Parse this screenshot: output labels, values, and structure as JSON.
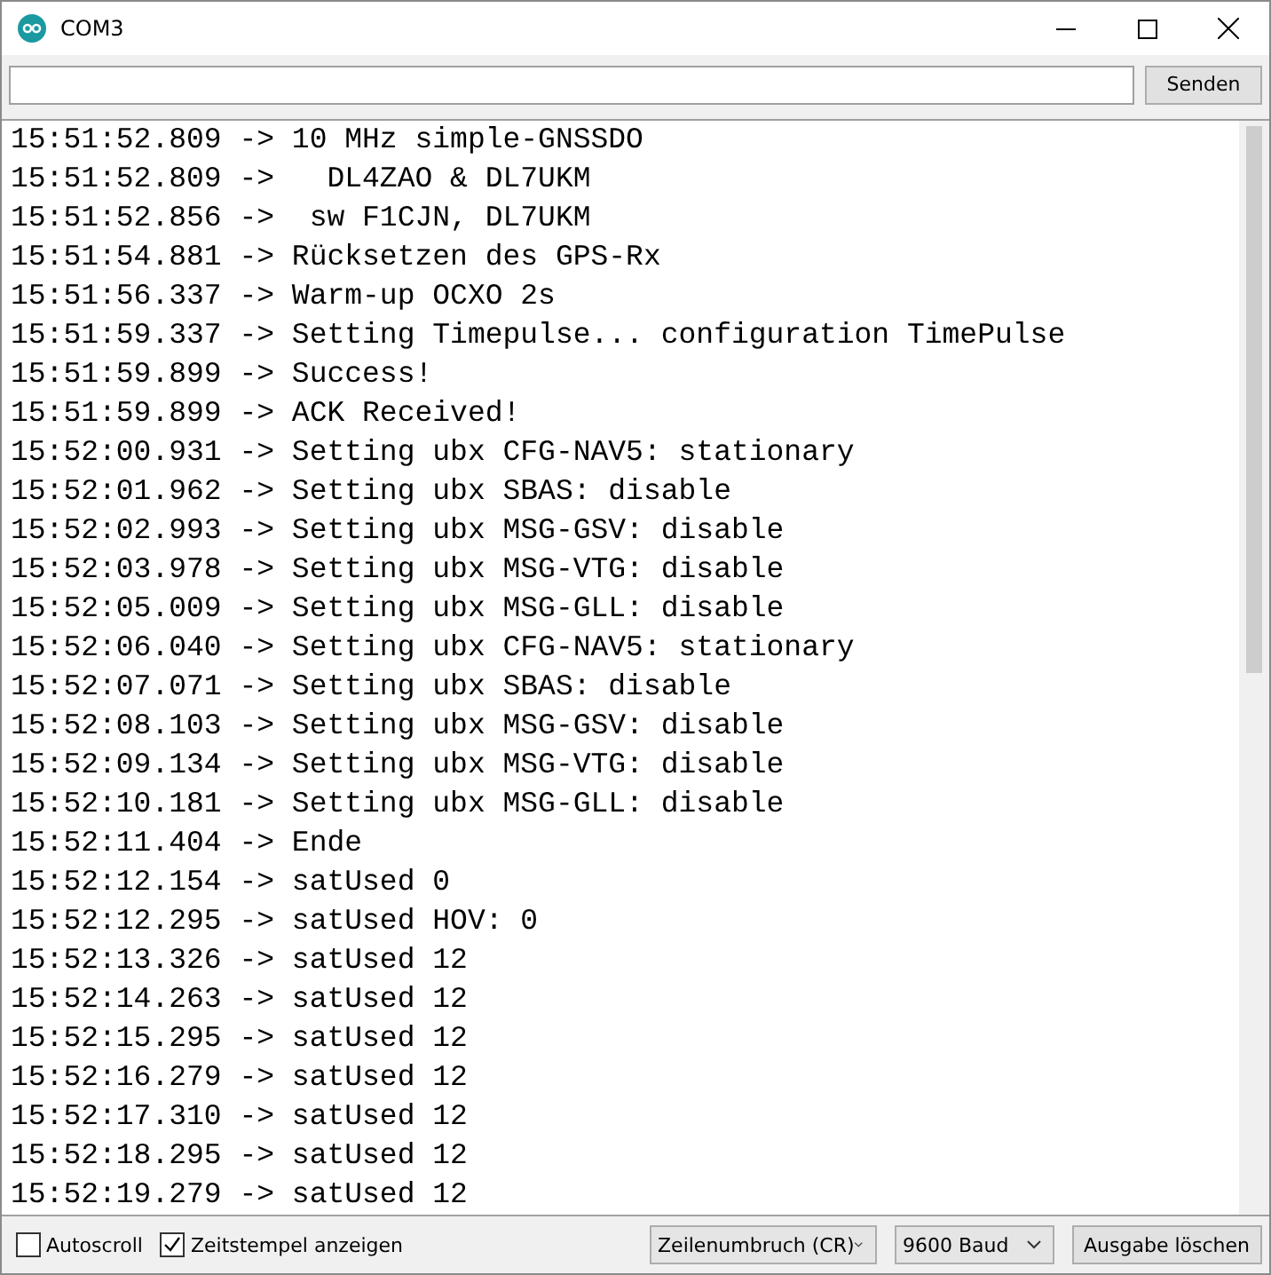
{
  "window": {
    "title": "COM3"
  },
  "send_button": "Senden",
  "output_lines": [
    "15:51:52.809 -> 10 MHz simple-GNSSDO",
    "15:51:52.809 ->   DL4ZAO & DL7UKM",
    "15:51:52.856 ->  sw F1CJN, DL7UKM",
    "15:51:54.881 -> Rücksetzen des GPS-Rx",
    "15:51:56.337 -> Warm-up OCXO 2s",
    "15:51:59.337 -> Setting Timepulse... configuration TimePulse",
    "15:51:59.899 -> Success!",
    "15:51:59.899 -> ACK Received!",
    "15:52:00.931 -> Setting ubx CFG-NAV5: stationary",
    "15:52:01.962 -> Setting ubx SBAS: disable",
    "15:52:02.993 -> Setting ubx MSG-GSV: disable",
    "15:52:03.978 -> Setting ubx MSG-VTG: disable",
    "15:52:05.009 -> Setting ubx MSG-GLL: disable",
    "15:52:06.040 -> Setting ubx CFG-NAV5: stationary",
    "15:52:07.071 -> Setting ubx SBAS: disable",
    "15:52:08.103 -> Setting ubx MSG-GSV: disable",
    "15:52:09.134 -> Setting ubx MSG-VTG: disable",
    "15:52:10.181 -> Setting ubx MSG-GLL: disable",
    "15:52:11.404 -> Ende",
    "15:52:12.154 -> satUsed 0",
    "15:52:12.295 -> satUsed HOV: 0",
    "15:52:13.326 -> satUsed 12",
    "15:52:14.263 -> satUsed 12",
    "15:52:15.295 -> satUsed 12",
    "15:52:16.279 -> satUsed 12",
    "15:52:17.310 -> satUsed 12",
    "15:52:18.295 -> satUsed 12",
    "15:52:19.279 -> satUsed 12"
  ],
  "options": [
    {
      "label": "Autoscroll",
      "checked": false
    },
    {
      "label": "Zeitstempel anzeigen",
      "checked": true
    }
  ],
  "line_ending": "Zeilenumbruch (CR)",
  "baud_rate": "9600 Baud",
  "clear_button": "Ausgabe löschen"
}
